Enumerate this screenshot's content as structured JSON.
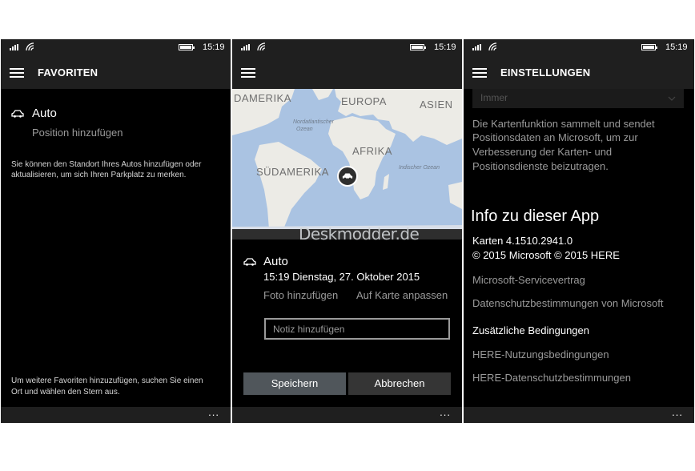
{
  "status": {
    "time": "15:19"
  },
  "favoriten": {
    "title": "FAVORITEN",
    "auto_label": "Auto",
    "add_position": "Position hinzufügen",
    "info_line1": "Sie können den Standort Ihres Autos hinzufügen oder",
    "info_line2": "aktualisieren, um sich Ihren Parkplatz zu merken.",
    "hint_line1": "Um weitere Favoriten hinzuzufügen, suchen Sie einen",
    "hint_line2": "Ort und wählen den Stern aus.",
    "more": "..."
  },
  "detail": {
    "map": {
      "labels": [
        "DAMERIKA",
        "EUROPA",
        "ASIEN",
        "AFRIKA",
        "SÜDAMERIKA"
      ],
      "ocean_north_1": "Nordatlantischer",
      "ocean_north_2": "Ozean",
      "ocean_indian_1": "Indischer Ozean",
      "watermark": "Deskmodder.de"
    },
    "auto_label": "Auto",
    "datetime": "15:19 Dienstag, 27. Oktober 2015",
    "add_photo": "Foto hinzufügen",
    "adjust_map": "Auf Karte anpassen",
    "note_placeholder": "Notiz hinzufügen",
    "save": "Speichern",
    "cancel": "Abbrechen",
    "more": "..."
  },
  "settings": {
    "title": "EINSTELLUNGEN",
    "dropdown_value": "Immer",
    "desc_line1": "Die Kartenfunktion sammelt und sendet",
    "desc_line2": "Positionsdaten an Microsoft, um zur",
    "desc_line3": "Verbesserung der Karten- und",
    "desc_line4": "Positionsdienste beizutragen.",
    "about_heading": "Info zu dieser App",
    "version": "Karten 4.1510.2941.0",
    "copyright": "© 2015 Microsoft © 2015 HERE",
    "links": [
      "Microsoft-Servicevertrag",
      "Datenschutzbestimmungen von Microsoft",
      "Zusätzliche Bedingungen",
      "HERE-Nutzungsbedingungen",
      "HERE-Datenschutzbestimmungen"
    ],
    "more": "..."
  }
}
